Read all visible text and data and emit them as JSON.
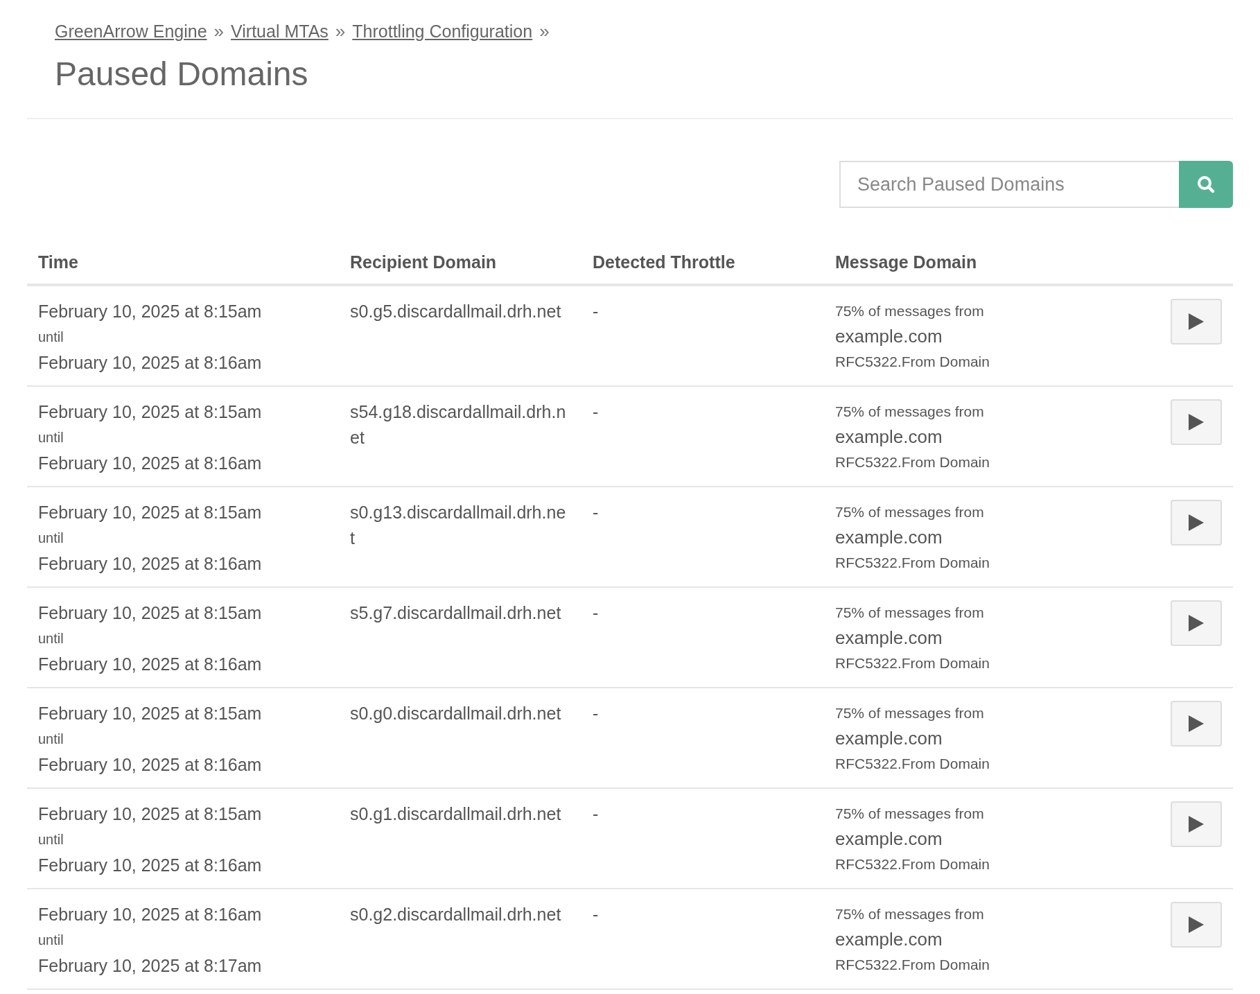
{
  "breadcrumb": [
    {
      "label": "GreenArrow Engine",
      "separator": "»"
    },
    {
      "label": "Virtual MTAs",
      "separator": "»"
    },
    {
      "label": "Throttling Configuration",
      "separator": "»"
    }
  ],
  "title": "Paused Domains",
  "search": {
    "placeholder": "Search Paused Domains"
  },
  "table": {
    "columns": [
      "Time",
      "Recipient Domain",
      "Detected Throttle",
      "Message Domain"
    ],
    "rows": [
      {
        "start": "February 10, 2025 at 8:15am",
        "until": "until",
        "end": "February 10, 2025 at 8:16am",
        "recipient": "s0.g5.discardallmail.drh.net",
        "throttle": "-",
        "share": "75% of messages from",
        "domain": "example.com",
        "source": "RFC5322.From Domain"
      },
      {
        "start": "February 10, 2025 at 8:15am",
        "until": "until",
        "end": "February 10, 2025 at 8:16am",
        "recipient": "s54.g18.discardallmail.drh.net",
        "throttle": "-",
        "share": "75% of messages from",
        "domain": "example.com",
        "source": "RFC5322.From Domain"
      },
      {
        "start": "February 10, 2025 at 8:15am",
        "until": "until",
        "end": "February 10, 2025 at 8:16am",
        "recipient": "s0.g13.discardallmail.drh.net",
        "throttle": "-",
        "share": "75% of messages from",
        "domain": "example.com",
        "source": "RFC5322.From Domain"
      },
      {
        "start": "February 10, 2025 at 8:15am",
        "until": "until",
        "end": "February 10, 2025 at 8:16am",
        "recipient": "s5.g7.discardallmail.drh.net",
        "throttle": "-",
        "share": "75% of messages from",
        "domain": "example.com",
        "source": "RFC5322.From Domain"
      },
      {
        "start": "February 10, 2025 at 8:15am",
        "until": "until",
        "end": "February 10, 2025 at 8:16am",
        "recipient": "s0.g0.discardallmail.drh.net",
        "throttle": "-",
        "share": "75% of messages from",
        "domain": "example.com",
        "source": "RFC5322.From Domain"
      },
      {
        "start": "February 10, 2025 at 8:15am",
        "until": "until",
        "end": "February 10, 2025 at 8:16am",
        "recipient": "s0.g1.discardallmail.drh.net",
        "throttle": "-",
        "share": "75% of messages from",
        "domain": "example.com",
        "source": "RFC5322.From Domain"
      },
      {
        "start": "February 10, 2025 at 8:16am",
        "until": "until",
        "end": "February 10, 2025 at 8:17am",
        "recipient": "s0.g2.discardallmail.drh.net",
        "throttle": "-",
        "share": "75% of messages from",
        "domain": "example.com",
        "source": "RFC5322.From Domain"
      }
    ]
  }
}
